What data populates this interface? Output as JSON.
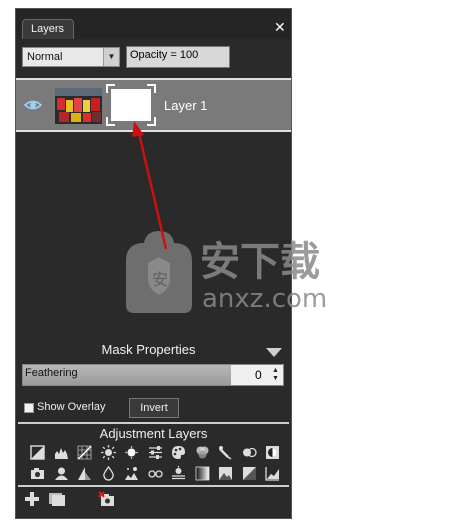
{
  "panel": {
    "tab_label": "Layers",
    "close_glyph": "✕"
  },
  "toolbar": {
    "blend_mode": "Normal",
    "opacity_text": "Opacity = 100"
  },
  "layers": [
    {
      "name": "Layer 1",
      "visible": true
    }
  ],
  "mask_properties": {
    "title": "Mask Properties",
    "feathering_label": "Feathering",
    "feathering_value": "0",
    "show_overlay_label": "Show Overlay",
    "show_overlay_checked": false,
    "invert_label": "Invert"
  },
  "adjustment_layers": {
    "title": "Adjustment Layers",
    "row1": [
      "exposure-icon",
      "levels-icon",
      "curves-icon",
      "brightness-icon",
      "contrast-icon",
      "sliders-icon",
      "palette-icon",
      "hue-icon",
      "color-pick-icon",
      "circles-icon",
      "half-circle-icon"
    ],
    "row2": [
      "camera-icon",
      "person-icon",
      "triangle-icon",
      "drop-icon",
      "blur-icon",
      "glasses-icon",
      "grain-icon",
      "gradient-icon",
      "photo-icon",
      "contrast-square-icon",
      "chart-icon"
    ]
  },
  "bottom_icons": [
    "add-layer-icon",
    "duplicate-layer-icon",
    "delete-layer-icon"
  ],
  "watermark": {
    "text_cn": "安下载",
    "text_en": "anxz.com"
  },
  "colors": {
    "panel_bg": "#2a2a2a",
    "selected_row": "#7a7a7a",
    "annotation_arrow": "#cc1111"
  }
}
